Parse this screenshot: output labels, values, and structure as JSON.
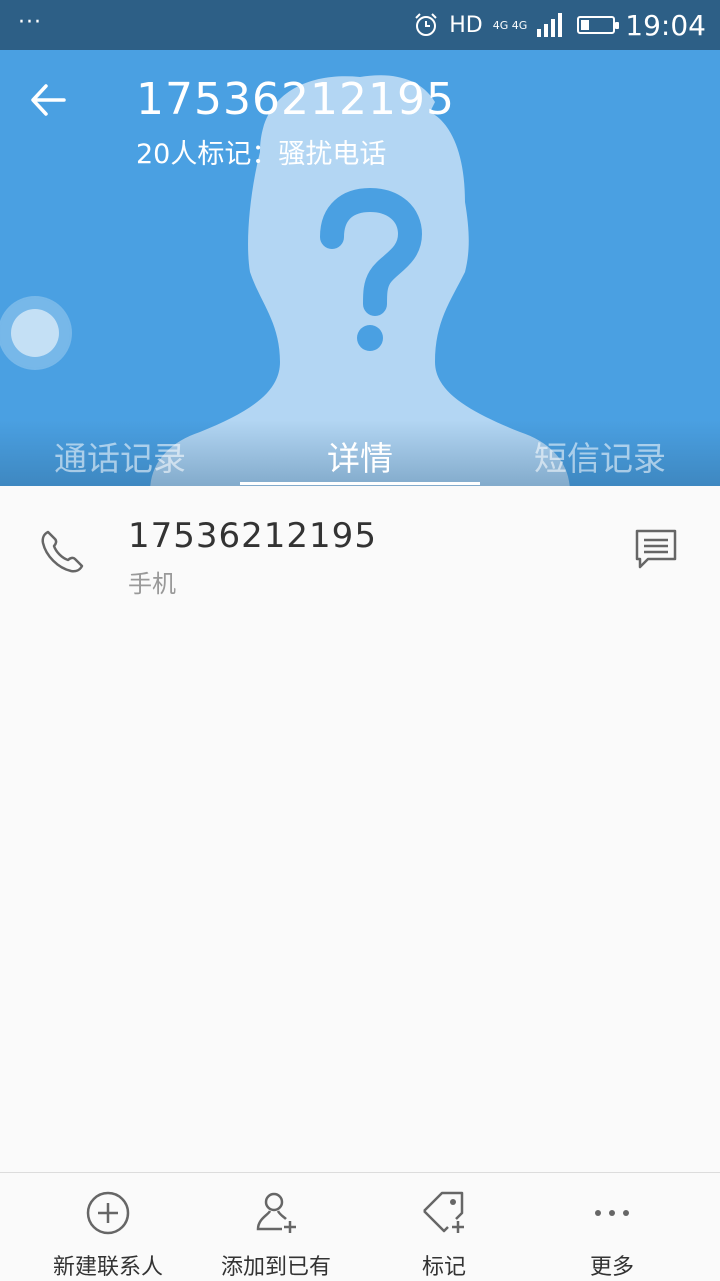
{
  "status_bar": {
    "dots": "···",
    "hd": "HD",
    "network_top": "4G 4G",
    "time": "19:04",
    "battery_level": 0.25
  },
  "header": {
    "number": "17536212195",
    "subtitle": "20人标记：骚扰电话",
    "background": "#4aa0e2",
    "tabs": [
      {
        "label": "通话记录",
        "active": false
      },
      {
        "label": "详情",
        "active": true
      },
      {
        "label": "短信记录",
        "active": false
      }
    ]
  },
  "detail": {
    "number": "17536212195",
    "type": "手机"
  },
  "bottom_bar": {
    "items": [
      {
        "label": "新建联系人",
        "icon": "add-circle-icon"
      },
      {
        "label": "添加到已有",
        "icon": "add-person-icon"
      },
      {
        "label": "标记",
        "icon": "tag-icon"
      },
      {
        "label": "更多",
        "icon": "more-icon"
      }
    ]
  }
}
